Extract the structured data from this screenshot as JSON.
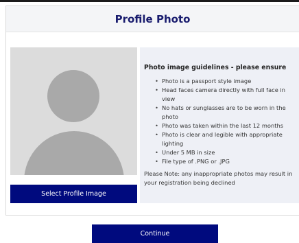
{
  "header": {
    "title": "Profile Photo"
  },
  "photo": {
    "select_label": "Select Profile Image",
    "placeholder_icon": "avatar-silhouette-icon"
  },
  "guidelines": {
    "title": "Photo image guidelines - please ensure",
    "items": [
      "Photo is a passport style image",
      "Head faces camera directly with full face in view",
      "No hats or sunglasses are to be worn in the photo",
      "Photo was taken within the last 12 months",
      "Photo is clear and legible with appropriate lighting",
      "Under 5 MB in size",
      "File type of .PNG or .JPG"
    ],
    "note": "Please Note: any inappropriate photos may result in your registration being declined"
  },
  "actions": {
    "continue_label": "Continue"
  },
  "colors": {
    "accent": "#000a7e",
    "title": "#191c6e",
    "guide_bg": "#eef0f6",
    "header_bg": "#f4f5f7"
  }
}
